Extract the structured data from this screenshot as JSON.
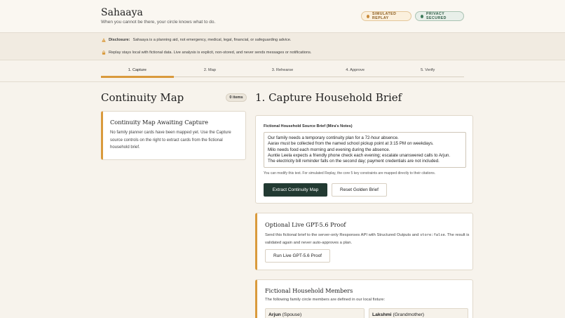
{
  "header": {
    "brand": "Sahaaya",
    "tagline": "When you cannot be there, your circle knows what to do.",
    "badges": {
      "simulated": "SIMULATED REPLAY",
      "privacy": "PRIVACY SECURED"
    }
  },
  "banner": {
    "disclosure_label": "Disclosure:",
    "disclosure_text": "Sahaaya is a planning aid, not emergency, medical, legal, financial, or safeguarding advice.",
    "replay_text": "Replay stays local with fictional data. Live analysis is explicit, non-stored, and never sends messages or notifications."
  },
  "steps": [
    "1. Capture",
    "2. Map",
    "3. Rehearse",
    "4. Approve",
    "5. Verify"
  ],
  "active_step": 0,
  "continuity": {
    "title": "Continuity Map",
    "count": "0 items",
    "empty_title": "Continuity Map Awaiting Capture",
    "empty_body": "No family planner cards have been mapped yet. Use the Capture source controls on the right to extract cards from the fictional household brief."
  },
  "capture": {
    "title": "1. Capture Household Brief",
    "source_label": "Fictional Household Source Brief (Mira's Notes)",
    "source_text": "Our family needs a temporary continuity plan for a 72-hour absence.\nAarav must be collected from the named school pickup point at 3:15 PM on weekdays.\nMilo needs food each morning and evening during the absence.\nAuntie Leela expects a friendly phone check each evening; escalate unanswered calls to Arjun.\nThe electricity bill reminder falls on the second day; payment credentials are not included.",
    "help_text": "You can modify this text. For simulated Replay, the core 5 key constraints are mapped directly to their citations.",
    "extract_button": "Extract Continuity Map",
    "reset_button": "Reset Golden Brief"
  },
  "proof": {
    "title": "Optional Live GPT-5.6 Proof",
    "body_pre": "Send this fictional brief to the server-only Responses API with Structured Outputs and",
    "body_code": "store:false",
    "body_post": ". The result is validated again and never auto-approves a plan.",
    "button": "Run Live GPT-5.6 Proof"
  },
  "members": {
    "title": "Fictional Household Members",
    "intro": "The following family circle members are defined in our local fixture:",
    "list": [
      {
        "name": "Arjun",
        "role": "(Spouse)"
      },
      {
        "name": "Lakshmi",
        "role": "(Grandmother)"
      }
    ]
  },
  "colors": {
    "accent": "#d99a3c",
    "primary_button": "#223a32",
    "background": "#f7f3ec"
  }
}
